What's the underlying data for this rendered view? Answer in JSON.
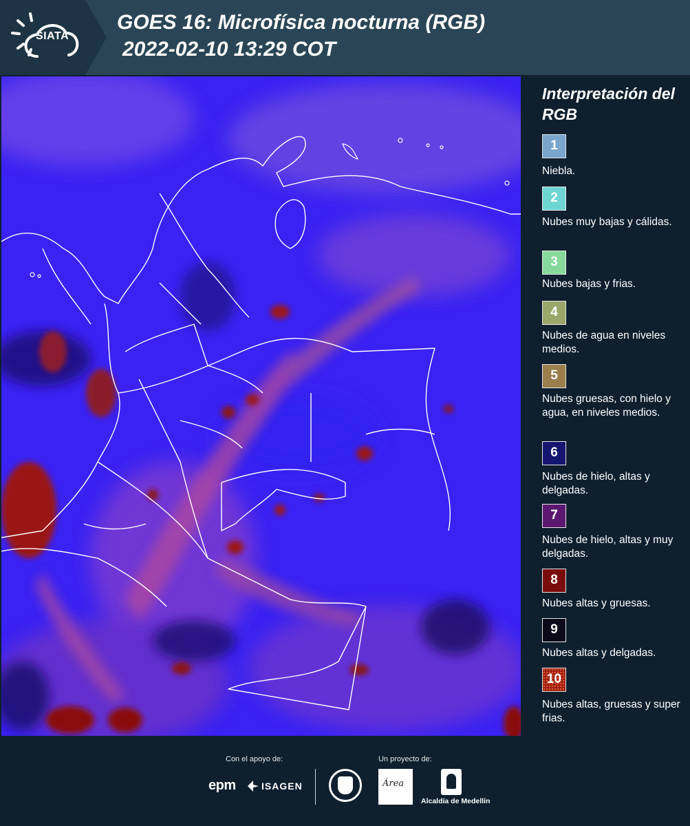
{
  "header": {
    "logo_text": "SIATA",
    "title_line1": "GOES 16: Microfísica nocturna (RGB)",
    "title_line2": "2022-02-10 13:29 COT"
  },
  "legend": {
    "title": "Interpretación del RGB",
    "items": [
      {
        "number": "1",
        "label": "Niebla.",
        "color": "#7aa5cc"
      },
      {
        "number": "2",
        "label": "Nubes muy bajas y cálidas.",
        "color": "#6ed6d2"
      },
      {
        "number": "3",
        "label": "Nubes bajas y frias.",
        "color": "#86d99a"
      },
      {
        "number": "4",
        "label": "Nubes de agua en niveles medios.",
        "color": "#9ba76a"
      },
      {
        "number": "5",
        "label": "Nubes gruesas, con hielo y agua, en niveles medios.",
        "color": "#9a7e4c"
      },
      {
        "number": "6",
        "label": "Nubes de hielo, altas y delgadas.",
        "color": "#141670"
      },
      {
        "number": "7",
        "label": "Nubes de hielo, altas y muy delgadas.",
        "color": "#5c1870"
      },
      {
        "number": "8",
        "label": "Nubes altas y gruesas.",
        "color": "#7a0c0c"
      },
      {
        "number": "9",
        "label": "Nubes altas y delgadas.",
        "color": "#0c0a18"
      },
      {
        "number": "10",
        "label": "Nubes altas, gruesas y super frias.",
        "color": "#9a1c0c"
      }
    ]
  },
  "footer": {
    "support_label": "Con el apoyo de:",
    "project_label": "Un proyecto de:",
    "epm_logo": "epm",
    "isagen_logo": "ISAGEN",
    "area_logo": "Área",
    "alcaldia_logo": "Alcaldía de Medellín"
  }
}
